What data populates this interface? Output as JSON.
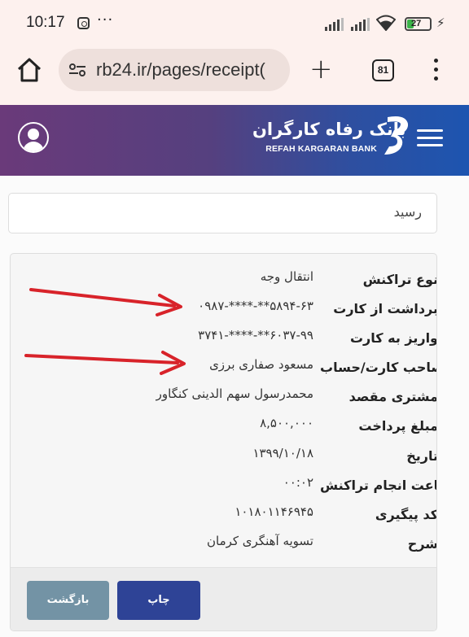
{
  "status_bar": {
    "time": "10:17",
    "notification_icon": "instagram-icon",
    "more_dots": "···",
    "battery_percent": "27",
    "charging_icon": "lightning-bolt-icon"
  },
  "browser": {
    "url": "rb24.ir/pages/receipt(",
    "tab_count": "81"
  },
  "bank": {
    "name_fa": "بانک رفاه کارگران",
    "name_en": "REFAH KARGARAN BANK",
    "brand_gradient": [
      "#6a3a7a",
      "#1d55b0"
    ]
  },
  "page": {
    "title": "رسید"
  },
  "receipt": {
    "rows": [
      {
        "label": "نوع تراکنش",
        "value": "انتقال وجه"
      },
      {
        "label": "برداشت از کارت",
        "value": "۵۸۹۴-۶۳**-****-۰۹۸۷"
      },
      {
        "label": "واریز به کارت",
        "value": "۶۰۳۷-۹۹**-****-۳۷۴۱"
      },
      {
        "label": "صاحب کارت/حساب",
        "value": "مسعود صفاری برزی"
      },
      {
        "label": "مشتری مقصد",
        "value": "محمدرسول سهم الدینی کنگاور"
      },
      {
        "label": "مبلغ پرداخت",
        "value": "۸,۵۰۰,۰۰۰"
      },
      {
        "label": "تاریخ",
        "value": "۱۳۹۹/۱۰/۱۸"
      },
      {
        "label": "ساعت انجام تراکنش",
        "value": "۰۰:۰۲"
      },
      {
        "label": "کد پیگیری",
        "value": "۱۰۱۸۰۱۱۴۶۹۴۵"
      },
      {
        "label": "شرح",
        "value": "تسویه آهنگری کرمان"
      }
    ],
    "print_label": "چاپ",
    "back_label": "بازگشت",
    "print_color": "#2e4396",
    "back_color": "#7393a5"
  },
  "annotations": {
    "arrow_color": "#d8232a"
  }
}
